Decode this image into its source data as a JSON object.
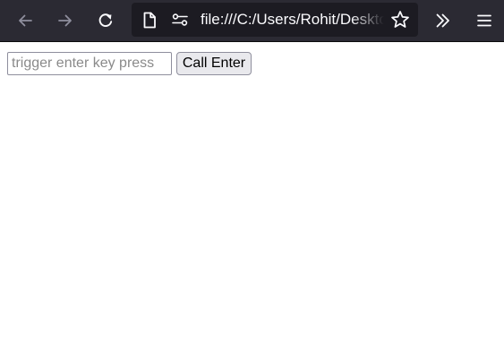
{
  "browser": {
    "url": "file:///C:/Users/Rohit/Desktop",
    "icons": {
      "back": "arrow-left-icon",
      "forward": "arrow-right-icon",
      "reload": "reload-icon",
      "page": "page-icon",
      "permissions": "permissions-icon",
      "bookmark": "star-icon",
      "overflow": "double-chevron-icon",
      "menu": "hamburger-menu-icon"
    },
    "colors": {
      "toolbar": "#2b2a33",
      "urlbar": "#1c1b22",
      "icon": "#fbfbfe",
      "icon_disabled": "#8f8f9d"
    }
  },
  "page": {
    "input": {
      "placeholder": "trigger enter key press",
      "value": ""
    },
    "button": {
      "label": "Call Enter"
    }
  }
}
